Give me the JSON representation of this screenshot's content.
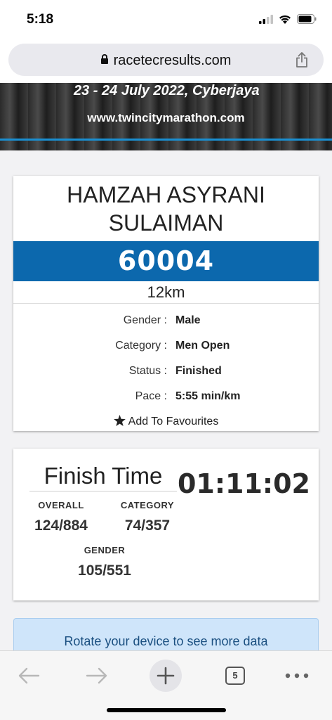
{
  "status_bar": {
    "time": "5:18"
  },
  "browser": {
    "url": "racetecresults.com",
    "tab_count": "5"
  },
  "banner": {
    "date_text": "23 - 24 July 2022, Cyberjaya",
    "site_url": "www.twincitymarathon.com"
  },
  "runner": {
    "name_line1": "HAMZAH ASYRANI",
    "name_line2": "SULAIMAN",
    "bib": "60004",
    "distance": "12km",
    "details": [
      {
        "label": "Gender :",
        "value": "Male"
      },
      {
        "label": "Category :",
        "value": "Men Open"
      },
      {
        "label": "Status :",
        "value": "Finished"
      },
      {
        "label": "Pace :",
        "value": "5:55 min/km"
      }
    ],
    "favourites_label": "Add To Favourites"
  },
  "results": {
    "finish_title": "Finish Time",
    "finish_time": "01:11:02",
    "overall_label": "OVERALL",
    "overall_value": "124/884",
    "category_label": "CATEGORY",
    "category_value": "74/357",
    "gender_label": "GENDER",
    "gender_value": "105/551"
  },
  "notice": {
    "text": "Rotate your device to see more data"
  },
  "colors": {
    "bib_band": "#0c68ad",
    "banner_line": "#1a8fd1",
    "notice_bg": "#cfe5fa"
  }
}
